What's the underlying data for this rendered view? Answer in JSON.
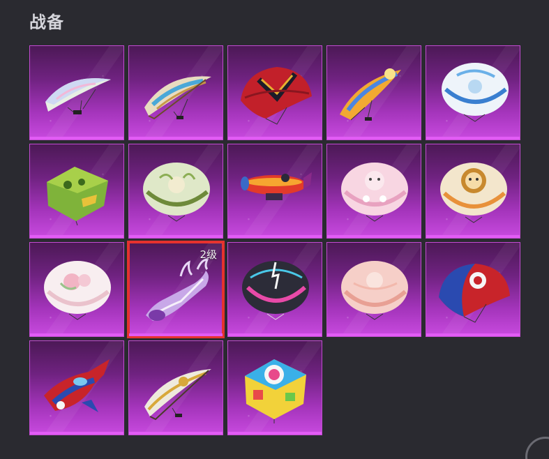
{
  "header": {
    "title": "战备"
  },
  "items": [
    {
      "icon": "parachute-glider-pastel-icon",
      "level": ""
    },
    {
      "icon": "parachute-glider-tribal-icon",
      "level": ""
    },
    {
      "icon": "parachute-red-armor-icon",
      "level": ""
    },
    {
      "icon": "parachute-glider-sunburst-icon",
      "level": ""
    },
    {
      "icon": "parachute-blue-dragon-icon",
      "level": ""
    },
    {
      "icon": "parachute-green-cake-icon",
      "level": ""
    },
    {
      "icon": "parachute-green-floral-icon",
      "level": ""
    },
    {
      "icon": "airship-red-icon",
      "level": ""
    },
    {
      "icon": "parachute-pink-bear-icon",
      "level": ""
    },
    {
      "icon": "parachute-lion-icon",
      "level": ""
    },
    {
      "icon": "parachute-pink-rose-icon",
      "level": ""
    },
    {
      "icon": "glider-purple-flame-icon",
      "level": "2级"
    },
    {
      "icon": "parachute-neon-pink-icon",
      "level": ""
    },
    {
      "icon": "parachute-soft-pink-icon",
      "level": ""
    },
    {
      "icon": "parachute-red-blue-spider-icon",
      "level": ""
    },
    {
      "icon": "jet-red-blue-icon",
      "level": ""
    },
    {
      "icon": "parachute-glider-white-gold-icon",
      "level": ""
    },
    {
      "icon": "parachute-rainbow-box-icon",
      "level": ""
    }
  ],
  "selected_index": 11,
  "colors": {
    "selection": "#e5322e",
    "card_border": "#c24bd1",
    "background": "#2a2a30"
  }
}
